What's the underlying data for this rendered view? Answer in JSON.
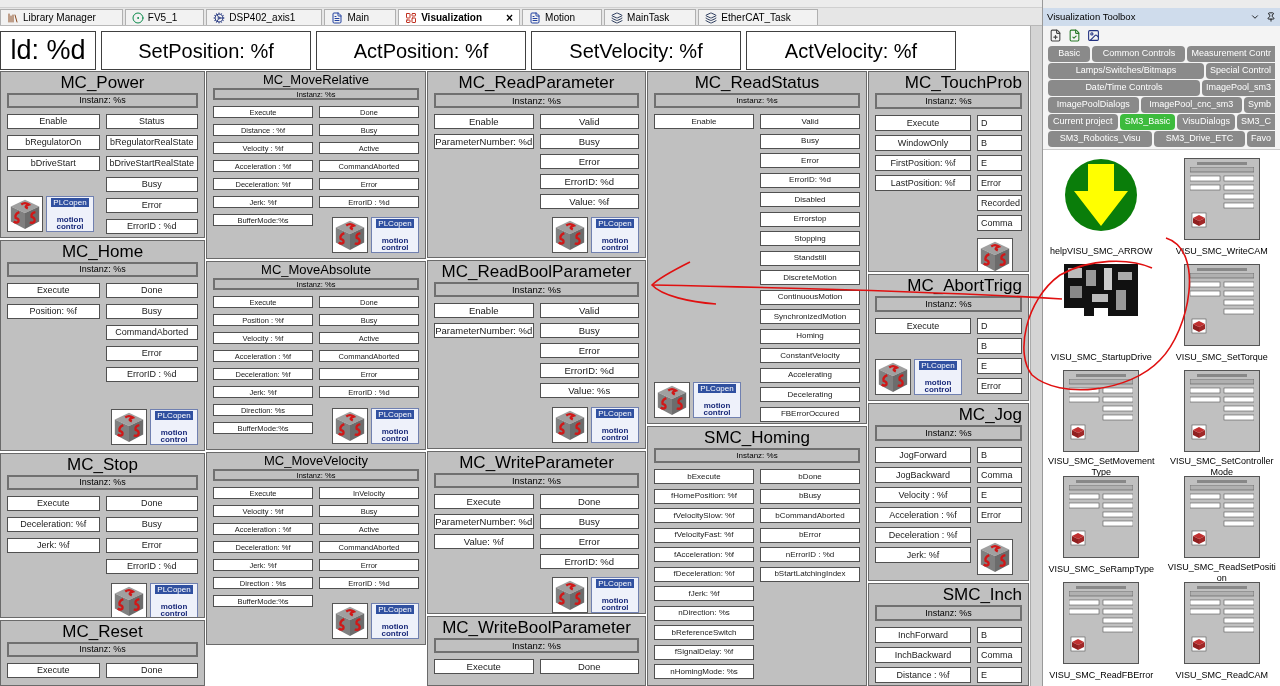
{
  "tabs": [
    {
      "label": "Library Manager",
      "selected": false
    },
    {
      "label": "FV5_1",
      "selected": false
    },
    {
      "label": "DSP402_axis1",
      "selected": false
    },
    {
      "label": "Main",
      "selected": false
    },
    {
      "label": "Visualization",
      "selected": true,
      "close": "×"
    },
    {
      "label": "Motion",
      "selected": false
    },
    {
      "label": "MainTask",
      "selected": false
    },
    {
      "label": "EtherCAT_Task",
      "selected": false
    }
  ],
  "header_fields": [
    "ld: %d",
    "SetPosition: %f",
    "ActPosition: %f",
    "SetVelocity: %f",
    "ActVelocity: %f"
  ],
  "columns": [
    [
      {
        "title": "MC_Power",
        "instance": "Instanz: %s",
        "inputs": [
          "Enable",
          "bRegulatorOn",
          "bDriveStart"
        ],
        "outputs": [
          "Status",
          "bRegulatorRealState",
          "bDriveStartRealState",
          "Busy",
          "Error",
          "ErrorID : %d"
        ],
        "kind": "logos_left",
        "logo_text": [
          "PLCopen",
          "motion control"
        ]
      },
      {
        "title": "MC_Home",
        "instance": "Instanz: %s",
        "inputs": [
          "Execute",
          "Position: %f"
        ],
        "outputs": [
          "Done",
          "Busy",
          "CommandAborted",
          "Error",
          "ErrorID : %d"
        ],
        "kind": "logos_right",
        "logo_text": [
          "PLCopen",
          "motion control"
        ]
      },
      {
        "title": "MC_Stop",
        "instance": "Instanz: %s",
        "inputs": [
          "Execute",
          "Deceleration: %f",
          "Jerk: %f"
        ],
        "outputs": [
          "Done",
          "Busy",
          "Error",
          "ErrorID : %d"
        ],
        "kind": "logos_right",
        "logo_text": [
          "PLCopen",
          "motion control"
        ]
      },
      {
        "title": "MC_Reset",
        "instance": "Instanz: %s",
        "inputs": [
          "Execute"
        ],
        "outputs": [
          "Done"
        ],
        "kind": "plain"
      }
    ],
    [
      {
        "title": "MC_MoveRelative",
        "instance": "Instanz: %s",
        "inputs": [
          "Execute",
          "Distance : %f",
          "Velocity : %f",
          "Acceleration : %f",
          "Deceleration: %f",
          "Jerk: %f",
          "BufferMode:%s"
        ],
        "outputs": [
          "Done",
          "Busy",
          "Active",
          "CommandAborted",
          "Error",
          "ErrorID : %d"
        ],
        "kind": "logos_right",
        "logo_text": [
          "PLCopen",
          "motion control"
        ]
      },
      {
        "title": "MC_MoveAbsolute",
        "instance": "Instanz: %s",
        "inputs": [
          "Execute",
          "Position : %f",
          "Velocity : %f",
          "Acceleration : %f",
          "Deceleration: %f",
          "Jerk: %f",
          "Direction: %s",
          "BufferMode:%s"
        ],
        "outputs": [
          "Done",
          "Busy",
          "Active",
          "CommandAborted",
          "Error",
          "ErrorID : %d"
        ],
        "kind": "logos_right",
        "logo_text": [
          "PLCopen",
          "motion control"
        ]
      },
      {
        "title": "MC_MoveVelocity",
        "instance": "Instanz: %s",
        "inputs": [
          "Execute",
          "Velocity : %f",
          "Acceleration : %f",
          "Deceleration: %f",
          "Jerk: %f",
          "Direction : %s",
          "BufferMode:%s"
        ],
        "outputs": [
          "InVelocity",
          "Busy",
          "Active",
          "CommandAborted",
          "Error",
          "ErrorID : %d"
        ],
        "kind": "logos_right",
        "logo_text": [
          "PLCopen",
          "motion control"
        ]
      }
    ],
    [
      {
        "title": "MC_ReadParameter",
        "instance": "Instanz: %s",
        "inputs": [
          "Enable",
          "ParameterNumber: %d"
        ],
        "outputs": [
          "Valid",
          "Busy",
          "Error",
          "ErrorID: %d",
          "Value: %f"
        ],
        "kind": "logos_right",
        "logo_text": [
          "PLCopen",
          "motion control"
        ]
      },
      {
        "title": "MC_ReadBoolParameter",
        "instance": "Instanz: %s",
        "inputs": [
          "Enable",
          "ParameterNumber: %d"
        ],
        "outputs": [
          "Valid",
          "Busy",
          "Error",
          "ErrorID: %d",
          "Value: %s"
        ],
        "kind": "logos_right",
        "logo_text": [
          "PLCopen",
          "motion control"
        ]
      },
      {
        "title": "MC_WriteParameter",
        "instance": "Instanz: %s",
        "inputs": [
          "Execute",
          "ParameterNumber: %d",
          "Value: %f"
        ],
        "outputs": [
          "Done",
          "Busy",
          "Error",
          "ErrorID: %d"
        ],
        "kind": "logos_right",
        "logo_text": [
          "PLCopen",
          "motion control"
        ]
      },
      {
        "title": "MC_WriteBoolParameter",
        "instance": "Instanz: %s",
        "inputs": [
          "Execute"
        ],
        "outputs": [
          "Done"
        ],
        "kind": "plain"
      }
    ],
    [
      {
        "title": "MC_ReadStatus",
        "instance": "Instanz: %s",
        "inputs": [
          "Enable"
        ],
        "outputs": [
          "Valid",
          "Busy",
          "Error",
          "ErrorID: %d",
          "Disabled",
          "Errorstop",
          "Stopping",
          "Standstill",
          "DiscreteMotion",
          "ContinuousMotion",
          "SynchronizedMotion",
          "Homing",
          "ConstantVelocity",
          "Accelerating",
          "Decelerating",
          "FBErrorOccured"
        ],
        "kind": "logos_left",
        "logo_text": [
          "PLCopen",
          "motion control"
        ]
      },
      {
        "title": "SMC_Homing",
        "instance": "Instanz: %s",
        "inputs": [
          "bExecute",
          "fHomePosition: %f",
          "fVelocitySlow: %f",
          "fVelocityFast: %f",
          "fAcceleration: %f",
          "fDeceleration: %f",
          "fJerk: %f",
          "nDirection: %s",
          "bReferenceSwitch",
          "fSignalDelay: %f",
          "nHomingMode: %s"
        ],
        "outputs": [
          "bDone",
          "bBusy",
          "bCommandAborted",
          "bError",
          "nErrorID : %d",
          "bStartLatchingIndex"
        ],
        "kind": "plain"
      }
    ],
    [
      {
        "title": "MC_TouchProb",
        "instance": "Instanz: %s",
        "inputs": [
          "Execute",
          "WindowOnly",
          "FirstPosition: %f",
          "LastPosition: %f"
        ],
        "outputs": [
          "D",
          "B",
          "E",
          "Error",
          "Recorded",
          "Comma"
        ],
        "kind": "logos_right"
      },
      {
        "title": "MC_AbortTrigg",
        "instance": "Instanz: %s",
        "inputs": [
          "Execute"
        ],
        "outputs": [
          "D",
          "B",
          "E",
          "Error"
        ],
        "kind": "logos_left",
        "logo_text": [
          "PLCopen",
          "motion control"
        ]
      },
      {
        "title": "MC_Jog",
        "instance": "Instanz: %s",
        "inputs": [
          "JogForward",
          "JogBackward",
          "Velocity : %f",
          "Acceleration : %f",
          "Deceleration : %f",
          "Jerk: %f"
        ],
        "outputs": [
          "B",
          "Comma",
          "E",
          "Error"
        ],
        "kind": "logos_right"
      },
      {
        "title": "SMC_Inch",
        "instance": "Instanz: %s",
        "inputs": [
          "InchForward",
          "InchBackward",
          "Distance : %f"
        ],
        "outputs": [
          "B",
          "Comma",
          "E"
        ],
        "kind": "plain"
      }
    ]
  ],
  "toolbox": {
    "title": "Visualization Toolbox",
    "tab_rows": [
      [
        {
          "label": "Basic",
          "selected": false
        },
        {
          "label": "Common Controls",
          "selected": false
        },
        {
          "label": "Measurement Contr",
          "selected": false
        }
      ],
      [
        {
          "label": "Lamps/Switches/Bitmaps",
          "selected": false
        },
        {
          "label": "Special Control",
          "selected": false
        }
      ],
      [
        {
          "label": "Date/Time Controls",
          "selected": false
        },
        {
          "label": "ImagePool_sm3",
          "selected": false
        }
      ],
      [
        {
          "label": "ImagePoolDialogs",
          "selected": false
        },
        {
          "label": "ImagePool_cnc_sm3",
          "selected": false
        },
        {
          "label": "Symb",
          "selected": false
        }
      ],
      [
        {
          "label": "Current project",
          "selected": false
        },
        {
          "label": "SM3_Basic",
          "selected": true
        },
        {
          "label": "VisuDialogs",
          "selected": false
        },
        {
          "label": "SM3_C",
          "selected": false
        }
      ],
      [
        {
          "label": "SM3_Robotics_Visu",
          "selected": false
        },
        {
          "label": "SM3_Drive_ETC",
          "selected": false
        },
        {
          "label": "Favo",
          "selected": false
        }
      ]
    ],
    "items": [
      {
        "kind": "arrow",
        "label": "helpVISU_SMC_ARROW"
      },
      {
        "kind": "block",
        "label": "VISU_SMC_WriteCAM"
      },
      {
        "kind": "screen",
        "label": "VISU_SMC_StartupDrive"
      },
      {
        "kind": "block",
        "label": "VISU_SMC_SetTorque"
      },
      {
        "kind": "block",
        "label": "VISU_SMC_SetMovement Type"
      },
      {
        "kind": "block",
        "label": "VISU_SMC_SetController Mode"
      },
      {
        "kind": "block",
        "label": "VISU_SMC_SeRampType"
      },
      {
        "kind": "block",
        "label": "VISU_SMC_ReadSetPositi on"
      },
      {
        "kind": "block",
        "label": "VISU_SMC_ReadFBError"
      },
      {
        "kind": "block",
        "label": "VISU_SMC_ReadCAM"
      }
    ]
  }
}
